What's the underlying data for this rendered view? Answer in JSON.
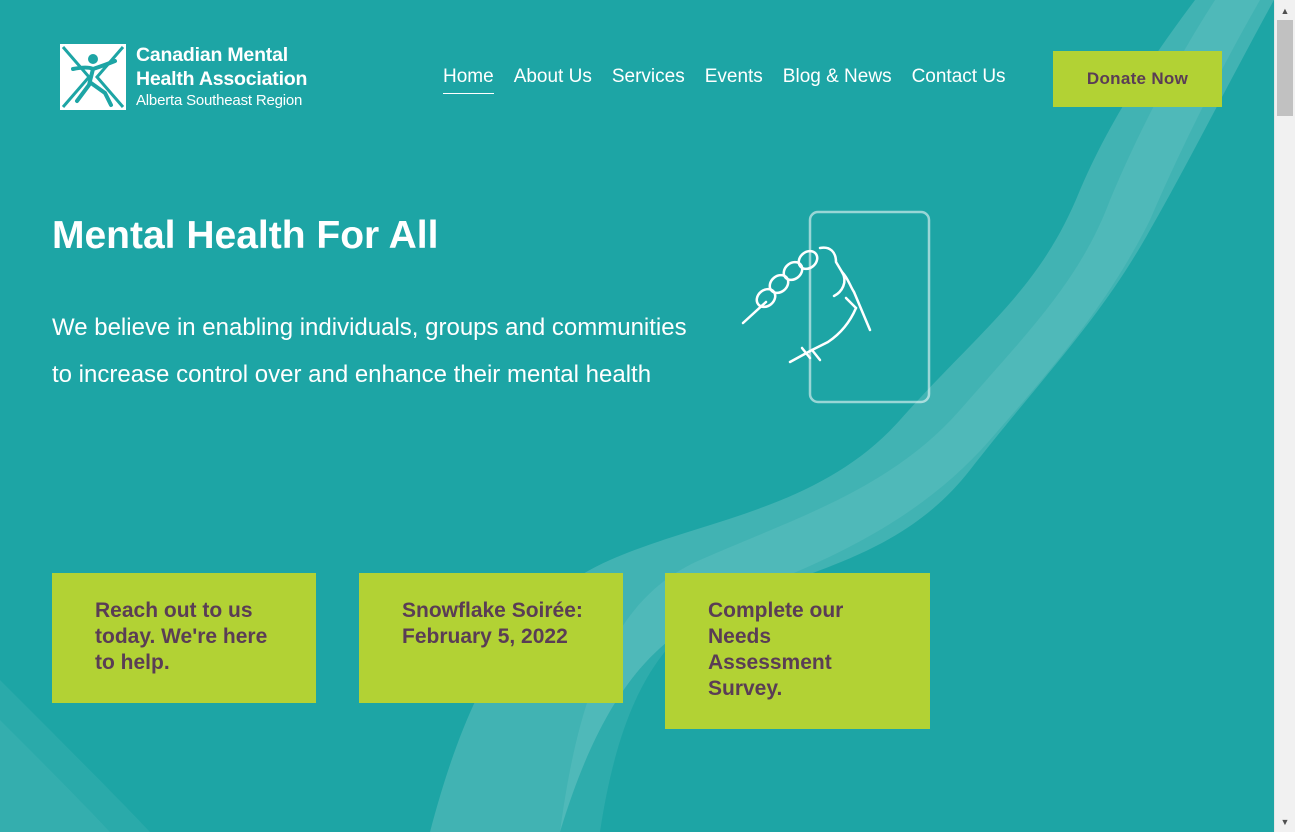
{
  "logo": {
    "line1": "Canadian Mental",
    "line2": "Health Association",
    "line3": "Alberta Southeast Region",
    "icon": "cmha-figure-logo"
  },
  "nav": {
    "items": [
      {
        "label": "Home",
        "active": true
      },
      {
        "label": "About Us",
        "active": false
      },
      {
        "label": "Services",
        "active": false
      },
      {
        "label": "Events",
        "active": false
      },
      {
        "label": "Blog & News",
        "active": false
      },
      {
        "label": "Contact Us",
        "active": false
      }
    ],
    "donate_label": "Donate Now"
  },
  "hero": {
    "title": "Mental Health For All",
    "text": "We believe in enabling individuals, groups and communities to increase control over and enhance their mental health",
    "icon": "hand-grip-icon"
  },
  "cards": [
    {
      "text": "Reach out to us today. We're here to help."
    },
    {
      "text": "Snowflake Soirée: February 5, 2022"
    },
    {
      "text": "Complete our Needs Assessment Survey."
    }
  ],
  "colors": {
    "background": "#1da5a5",
    "accent": "#b2d234",
    "card_text": "#5a3d55",
    "text": "#ffffff"
  }
}
